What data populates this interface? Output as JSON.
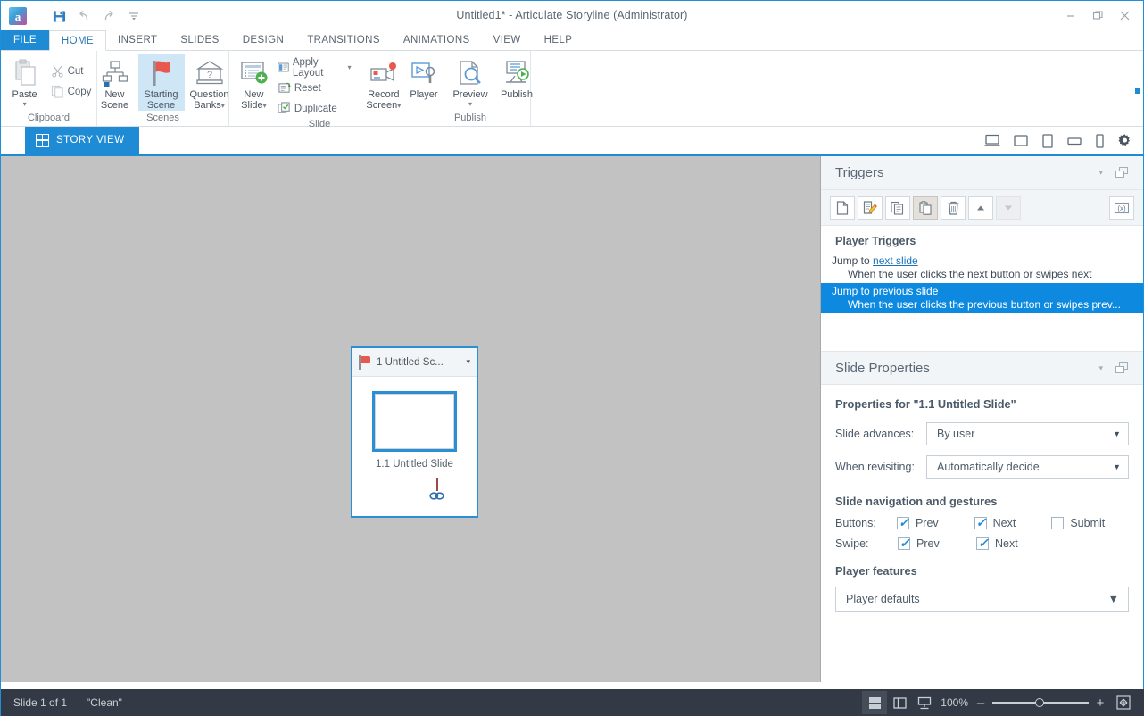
{
  "window": {
    "title": "Untitled1* -  Articulate Storyline (Administrator)",
    "logo_letter": "a",
    "minimize": "–",
    "restore": "❐",
    "close": "✕",
    "help_label": "?"
  },
  "quick_access": [
    {
      "name": "save-icon",
      "glyph": "▤"
    },
    {
      "name": "undo-icon",
      "glyph": "↰"
    },
    {
      "name": "redo-icon",
      "glyph": "↱"
    },
    {
      "name": "customize-qat-icon",
      "glyph": "⩒"
    }
  ],
  "ribbon": {
    "tabs": [
      {
        "label": "FILE"
      },
      {
        "label": "HOME"
      },
      {
        "label": "INSERT"
      },
      {
        "label": "SLIDES"
      },
      {
        "label": "DESIGN"
      },
      {
        "label": "TRANSITIONS"
      },
      {
        "label": "ANIMATIONS"
      },
      {
        "label": "VIEW"
      },
      {
        "label": "HELP"
      }
    ],
    "groups": {
      "clipboard": {
        "label": "Clipboard",
        "paste": "Paste",
        "paste_caret": "▾",
        "cut": "Cut",
        "copy": "Copy"
      },
      "scenes": {
        "label": "Scenes",
        "new_scene": "New\nScene",
        "new_scene_l1": "New",
        "new_scene_l2": "Scene",
        "starting_scene_l1": "Starting",
        "starting_scene_l2": "Scene",
        "question_banks_l1": "Question",
        "question_banks_l2": "Banks",
        "question_banks_caret": "▾"
      },
      "slide": {
        "label": "Slide",
        "new_slide_l1": "New",
        "new_slide_l2": "Slide",
        "new_slide_caret": "▾",
        "apply_layout": "Apply Layout",
        "apply_layout_caret": "▾",
        "reset": "Reset",
        "duplicate": "Duplicate",
        "record_screen_l1": "Record",
        "record_screen_l2": "Screen",
        "record_screen_caret": "▾"
      },
      "publish": {
        "label": "Publish",
        "player": "Player",
        "preview": "Preview",
        "preview_caret": "▾",
        "publish": "Publish"
      }
    }
  },
  "viewbar": {
    "story_view": "STORY VIEW",
    "device_icons": [
      {
        "name": "desktop-view-icon"
      },
      {
        "name": "tablet-landscape-view-icon"
      },
      {
        "name": "tablet-portrait-view-icon"
      },
      {
        "name": "phone-landscape-view-icon"
      },
      {
        "name": "phone-portrait-view-icon"
      },
      {
        "name": "player-settings-gear-icon"
      }
    ]
  },
  "canvas": {
    "scene": {
      "title": "1 Untitled Sc...",
      "caret": "▾",
      "slide_label": "1.1 Untitled Slide",
      "link_glyph": "👓"
    }
  },
  "triggers_panel": {
    "title": "Triggers",
    "collapse_caret": "▾",
    "toolbar": [
      {
        "name": "new-trigger-icon",
        "glyph": "▯"
      },
      {
        "name": "edit-trigger-icon",
        "glyph": "▤"
      },
      {
        "name": "copy-trigger-icon",
        "glyph": "⧉"
      },
      {
        "name": "paste-trigger-icon",
        "glyph": "▣"
      },
      {
        "name": "delete-trigger-icon",
        "glyph": "🗑"
      },
      {
        "name": "move-up-icon",
        "glyph": "▲"
      },
      {
        "name": "move-down-icon",
        "glyph": "▼"
      },
      {
        "name": "manage-variables-icon",
        "glyph": "(x)"
      }
    ],
    "section_label": "Player Triggers",
    "items": [
      {
        "action_prefix": "Jump to ",
        "action_target": "next slide",
        "condition": "When the user clicks the next button or swipes next",
        "selected": false
      },
      {
        "action_prefix": "Jump to ",
        "action_target": "previous slide",
        "condition": "When the user clicks the previous button or swipes prev...",
        "selected": true
      }
    ]
  },
  "slide_properties": {
    "title": "Slide Properties",
    "collapse_caret": "▾",
    "heading": "Properties for \"1.1 Untitled Slide\"",
    "slide_advances_label": "Slide advances:",
    "slide_advances_value": "By user",
    "when_revisiting_label": "When revisiting:",
    "when_revisiting_value": "Automatically decide",
    "nav_heading": "Slide navigation and gestures",
    "buttons_label": "Buttons:",
    "swipe_label": "Swipe:",
    "buttons": [
      {
        "label": "Prev",
        "checked": true
      },
      {
        "label": "Next",
        "checked": true
      },
      {
        "label": "Submit",
        "checked": false
      }
    ],
    "swipe": [
      {
        "label": "Prev",
        "checked": true
      },
      {
        "label": "Next",
        "checked": true
      }
    ],
    "player_features_heading": "Player features",
    "player_features_value": "Player defaults",
    "dropdown_arrow": "▼"
  },
  "statusbar": {
    "slide_count": "Slide 1 of 1",
    "theme": "\"Clean\"",
    "zoom_level": "100%",
    "zoom_minus": "–",
    "zoom_plus": "+",
    "icons": [
      {
        "name": "story-view-icon"
      },
      {
        "name": "slide-view-icon"
      },
      {
        "name": "presenter-view-icon"
      },
      {
        "name": "fit-to-window-icon"
      }
    ]
  },
  "colors": {
    "accent": "#1e8bd4",
    "selection": "#0d8ae0",
    "canvas": "#c2c2c2",
    "statusbar": "#333a45",
    "panel_header": "#f2f5f8"
  }
}
